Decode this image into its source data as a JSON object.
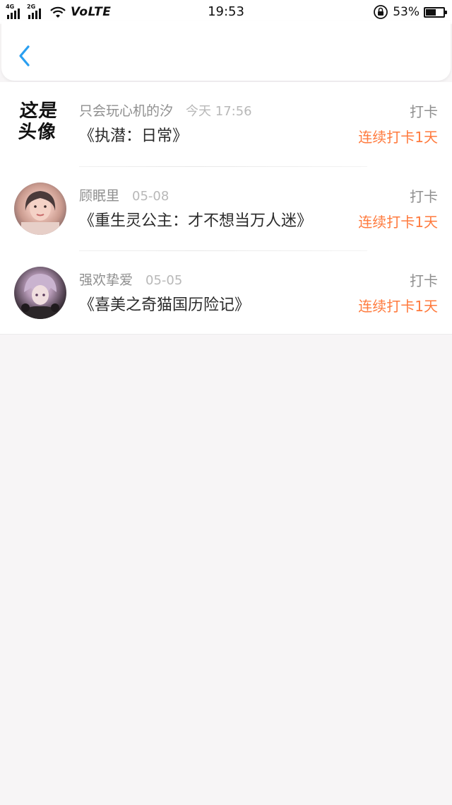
{
  "status_bar": {
    "net1": "4G",
    "net2": "2G",
    "volte": "VoLTE",
    "time": "19:53",
    "battery_percent_text": "53%",
    "battery_level": 0.53
  },
  "header": {
    "back_icon": "chevron-left-icon",
    "accent_color": "#2a9ff0"
  },
  "checkins": [
    {
      "user": "只会玩心机的汐",
      "date": "今天 17:56",
      "book": "《执潜：日常》",
      "action": "打卡",
      "streak": "连续打卡1天",
      "avatar_text": [
        "这是",
        "头像"
      ]
    },
    {
      "user": "顾眠里",
      "date": "05-08",
      "book": "《重生灵公主：才不想当万人迷》",
      "action": "打卡",
      "streak": "连续打卡1天"
    },
    {
      "user": "强欢挚爱",
      "date": "05-05",
      "book": "《喜美之奇猫国历险记》",
      "action": "打卡",
      "streak": "连续打卡1天"
    }
  ],
  "colors": {
    "streak": "#ff7a3d",
    "muted": "#8f8f8f",
    "background": "#f7f5f6"
  }
}
